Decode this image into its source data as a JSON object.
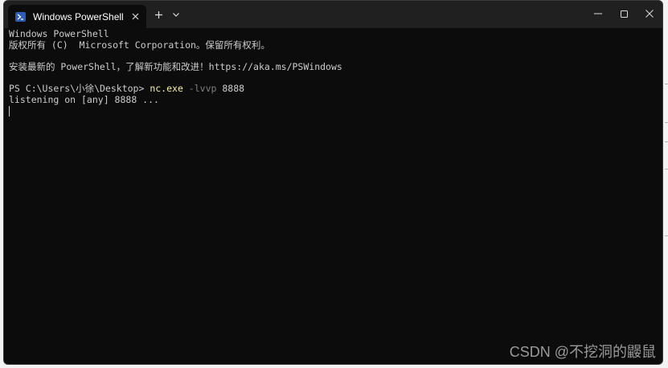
{
  "window": {
    "tab_title": "Windows PowerShell",
    "new_tab_symbol": "+",
    "dropdown_symbol": "⌄"
  },
  "terminal": {
    "lines": [
      "Windows PowerShell",
      "版权所有 (C)  Microsoft Corporation。保留所有权利。",
      "",
      "安装最新的 PowerShell，了解新功能和改进！https://aka.ms/PSWindows",
      ""
    ],
    "prompt": "PS C:\\Users\\小徐\\Desktop> ",
    "command": "nc.exe",
    "command_args": " -lvvp",
    "command_port": " 8888",
    "output": "listening on [any] 8888 ..."
  },
  "watermark": "CSDN @不挖洞的鼹鼠",
  "colors": {
    "background": "#0c0c0c",
    "titlebar": "#202020",
    "text": "#cccccc",
    "command": "#f9f1a5",
    "parameter": "#808080",
    "icon_blue": "#2b5cb8"
  }
}
